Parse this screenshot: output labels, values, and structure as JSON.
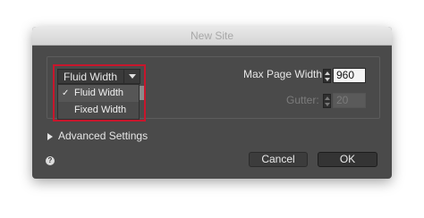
{
  "dialog": {
    "title": "New Site"
  },
  "layout_dropdown": {
    "selected": "Fluid Width",
    "options": [
      {
        "label": "Fluid Width",
        "checked": true
      },
      {
        "label": "Fixed Width",
        "checked": false
      }
    ],
    "check_glyph": "✓"
  },
  "max_page_width": {
    "label": "Max Page Width:",
    "value": "960"
  },
  "gutter": {
    "label": "Gutter:",
    "value": "20",
    "disabled": true
  },
  "advanced": {
    "label": "Advanced Settings"
  },
  "help": {
    "glyph": "?"
  },
  "buttons": {
    "cancel": "Cancel",
    "ok": "OK"
  },
  "colors": {
    "highlight": "#c8162c",
    "dialog_bg": "#4a4a4a"
  }
}
